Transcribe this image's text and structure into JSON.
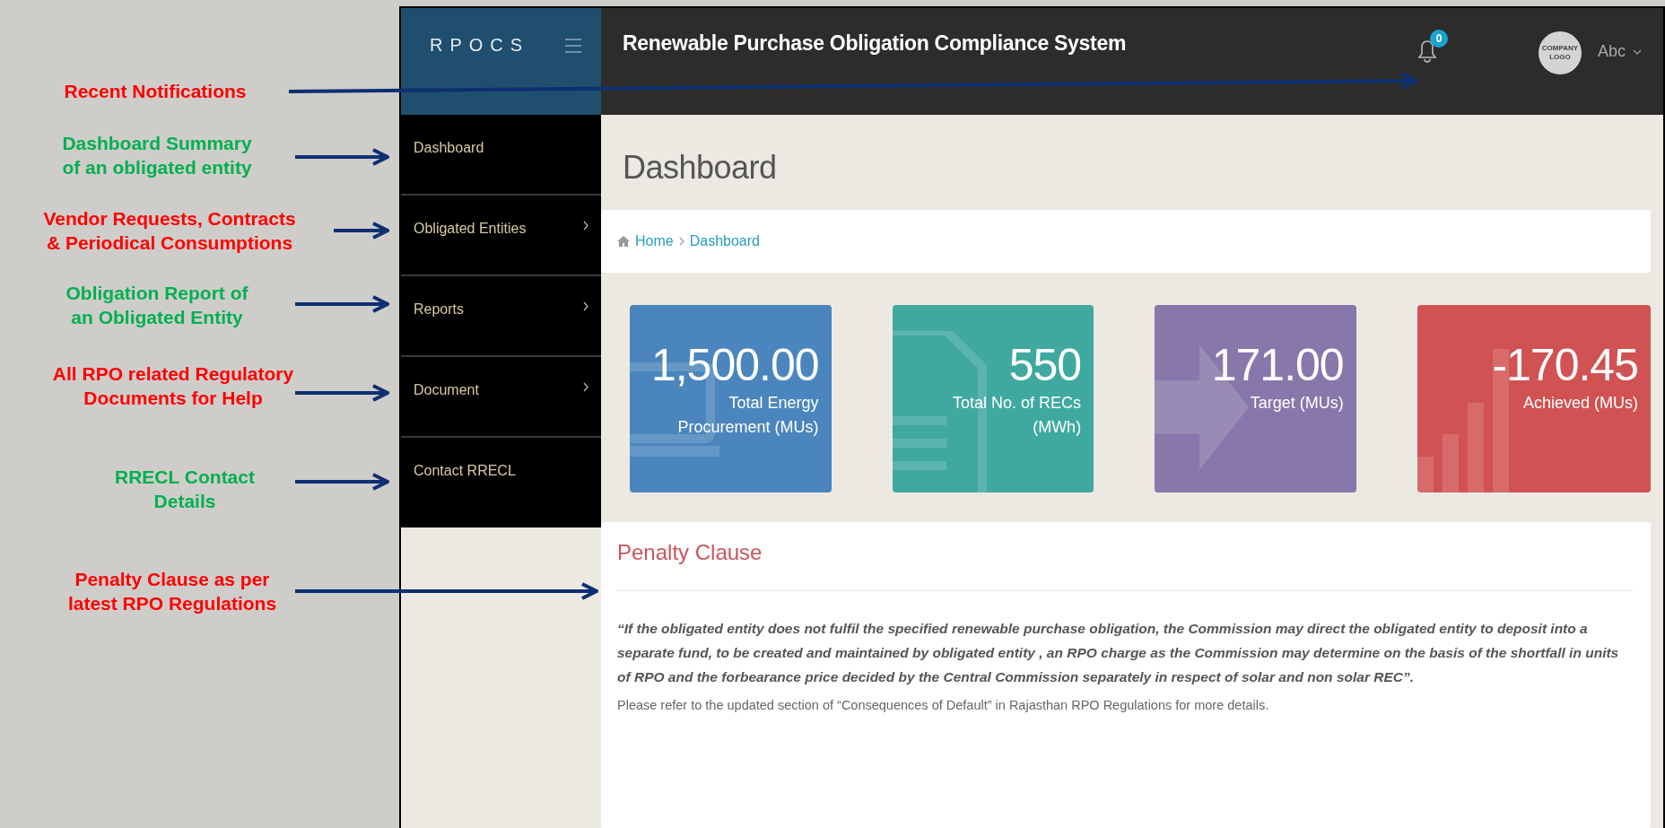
{
  "annotations": [
    {
      "lines": [
        "Recent Notifications"
      ],
      "color": "#ff0000"
    },
    {
      "lines": [
        "Dashboard Summary",
        "of an obligated entity"
      ],
      "color": "#00b050"
    },
    {
      "lines": [
        "Vendor Requests, Contracts",
        "& Periodical Consumptions"
      ],
      "color": "#ff0000"
    },
    {
      "lines": [
        "Obligation Report of",
        "an Obligated Entity"
      ],
      "color": "#00b050"
    },
    {
      "lines": [
        "All RPO related Regulatory",
        "Documents for Help"
      ],
      "color": "#ff0000"
    },
    {
      "lines": [
        "RRECL Contact",
        "Details"
      ],
      "color": "#00b050"
    },
    {
      "lines": [
        "Penalty Clause as per",
        "latest RPO Regulations"
      ],
      "color": "#ff0000"
    }
  ],
  "brand": "RPOCS",
  "header": {
    "title": "Renewable Purchase Obligation Compliance System",
    "notification_count": "0",
    "logo_text": [
      "COMPANY",
      "LOGO"
    ],
    "user": "Abc"
  },
  "sidebar": {
    "items": [
      {
        "label": "Dashboard",
        "has_submenu": false
      },
      {
        "label": "Obligated Entities",
        "has_submenu": true
      },
      {
        "label": "Reports",
        "has_submenu": true
      },
      {
        "label": "Document",
        "has_submenu": true
      },
      {
        "label": "Contact RRECL",
        "has_submenu": false
      }
    ]
  },
  "page_title": "Dashboard",
  "breadcrumb": [
    {
      "label": "Home"
    },
    {
      "label": "Dashboard"
    }
  ],
  "stats": [
    {
      "value": "1,500.00",
      "label": "Total Energy Procurement (MUs)",
      "color": "#4a86bd",
      "kind": "laptop"
    },
    {
      "value": "550",
      "label": "Total No. of RECs (MWh)",
      "color": "#3fa9a0",
      "kind": "document"
    },
    {
      "value": "171.00",
      "label": "Target (MUs)",
      "color": "#8777aa",
      "kind": "arrow"
    },
    {
      "value": "-170.45",
      "label": "Achieved (MUs)",
      "color": "#d05252",
      "kind": "bars"
    }
  ],
  "penalty": {
    "title": "Penalty Clause",
    "quote": "“If the obligated entity does not fulfil the specified renewable purchase obligation, the Commission may direct the obligated entity to deposit into a separate fund, to be created and maintained by obligated entity , an RPO charge as the Commission may determine on the basis of the shortfall in units of RPO and the forbearance price decided by the Central Commission separately in respect of solar and non solar REC”.",
    "note": "Please refer to the updated section of “Consequences of Default” in Rajasthan RPO Regulations for more details."
  }
}
